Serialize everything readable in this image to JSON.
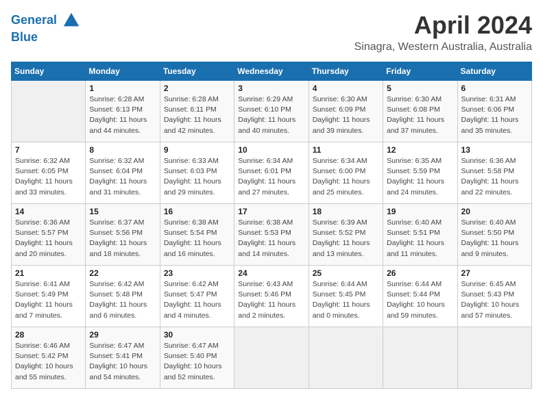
{
  "header": {
    "logo_line1": "General",
    "logo_line2": "Blue",
    "title": "April 2024",
    "subtitle": "Sinagra, Western Australia, Australia"
  },
  "weekdays": [
    "Sunday",
    "Monday",
    "Tuesday",
    "Wednesday",
    "Thursday",
    "Friday",
    "Saturday"
  ],
  "weeks": [
    [
      {
        "day": "",
        "empty": true
      },
      {
        "day": "1",
        "sunrise": "Sunrise: 6:28 AM",
        "sunset": "Sunset: 6:13 PM",
        "daylight": "Daylight: 11 hours and 44 minutes."
      },
      {
        "day": "2",
        "sunrise": "Sunrise: 6:28 AM",
        "sunset": "Sunset: 6:11 PM",
        "daylight": "Daylight: 11 hours and 42 minutes."
      },
      {
        "day": "3",
        "sunrise": "Sunrise: 6:29 AM",
        "sunset": "Sunset: 6:10 PM",
        "daylight": "Daylight: 11 hours and 40 minutes."
      },
      {
        "day": "4",
        "sunrise": "Sunrise: 6:30 AM",
        "sunset": "Sunset: 6:09 PM",
        "daylight": "Daylight: 11 hours and 39 minutes."
      },
      {
        "day": "5",
        "sunrise": "Sunrise: 6:30 AM",
        "sunset": "Sunset: 6:08 PM",
        "daylight": "Daylight: 11 hours and 37 minutes."
      },
      {
        "day": "6",
        "sunrise": "Sunrise: 6:31 AM",
        "sunset": "Sunset: 6:06 PM",
        "daylight": "Daylight: 11 hours and 35 minutes."
      }
    ],
    [
      {
        "day": "7",
        "sunrise": "Sunrise: 6:32 AM",
        "sunset": "Sunset: 6:05 PM",
        "daylight": "Daylight: 11 hours and 33 minutes."
      },
      {
        "day": "8",
        "sunrise": "Sunrise: 6:32 AM",
        "sunset": "Sunset: 6:04 PM",
        "daylight": "Daylight: 11 hours and 31 minutes."
      },
      {
        "day": "9",
        "sunrise": "Sunrise: 6:33 AM",
        "sunset": "Sunset: 6:03 PM",
        "daylight": "Daylight: 11 hours and 29 minutes."
      },
      {
        "day": "10",
        "sunrise": "Sunrise: 6:34 AM",
        "sunset": "Sunset: 6:01 PM",
        "daylight": "Daylight: 11 hours and 27 minutes."
      },
      {
        "day": "11",
        "sunrise": "Sunrise: 6:34 AM",
        "sunset": "Sunset: 6:00 PM",
        "daylight": "Daylight: 11 hours and 25 minutes."
      },
      {
        "day": "12",
        "sunrise": "Sunrise: 6:35 AM",
        "sunset": "Sunset: 5:59 PM",
        "daylight": "Daylight: 11 hours and 24 minutes."
      },
      {
        "day": "13",
        "sunrise": "Sunrise: 6:36 AM",
        "sunset": "Sunset: 5:58 PM",
        "daylight": "Daylight: 11 hours and 22 minutes."
      }
    ],
    [
      {
        "day": "14",
        "sunrise": "Sunrise: 6:36 AM",
        "sunset": "Sunset: 5:57 PM",
        "daylight": "Daylight: 11 hours and 20 minutes."
      },
      {
        "day": "15",
        "sunrise": "Sunrise: 6:37 AM",
        "sunset": "Sunset: 5:56 PM",
        "daylight": "Daylight: 11 hours and 18 minutes."
      },
      {
        "day": "16",
        "sunrise": "Sunrise: 6:38 AM",
        "sunset": "Sunset: 5:54 PM",
        "daylight": "Daylight: 11 hours and 16 minutes."
      },
      {
        "day": "17",
        "sunrise": "Sunrise: 6:38 AM",
        "sunset": "Sunset: 5:53 PM",
        "daylight": "Daylight: 11 hours and 14 minutes."
      },
      {
        "day": "18",
        "sunrise": "Sunrise: 6:39 AM",
        "sunset": "Sunset: 5:52 PM",
        "daylight": "Daylight: 11 hours and 13 minutes."
      },
      {
        "day": "19",
        "sunrise": "Sunrise: 6:40 AM",
        "sunset": "Sunset: 5:51 PM",
        "daylight": "Daylight: 11 hours and 11 minutes."
      },
      {
        "day": "20",
        "sunrise": "Sunrise: 6:40 AM",
        "sunset": "Sunset: 5:50 PM",
        "daylight": "Daylight: 11 hours and 9 minutes."
      }
    ],
    [
      {
        "day": "21",
        "sunrise": "Sunrise: 6:41 AM",
        "sunset": "Sunset: 5:49 PM",
        "daylight": "Daylight: 11 hours and 7 minutes."
      },
      {
        "day": "22",
        "sunrise": "Sunrise: 6:42 AM",
        "sunset": "Sunset: 5:48 PM",
        "daylight": "Daylight: 11 hours and 6 minutes."
      },
      {
        "day": "23",
        "sunrise": "Sunrise: 6:42 AM",
        "sunset": "Sunset: 5:47 PM",
        "daylight": "Daylight: 11 hours and 4 minutes."
      },
      {
        "day": "24",
        "sunrise": "Sunrise: 6:43 AM",
        "sunset": "Sunset: 5:46 PM",
        "daylight": "Daylight: 11 hours and 2 minutes."
      },
      {
        "day": "25",
        "sunrise": "Sunrise: 6:44 AM",
        "sunset": "Sunset: 5:45 PM",
        "daylight": "Daylight: 11 hours and 0 minutes."
      },
      {
        "day": "26",
        "sunrise": "Sunrise: 6:44 AM",
        "sunset": "Sunset: 5:44 PM",
        "daylight": "Daylight: 10 hours and 59 minutes."
      },
      {
        "day": "27",
        "sunrise": "Sunrise: 6:45 AM",
        "sunset": "Sunset: 5:43 PM",
        "daylight": "Daylight: 10 hours and 57 minutes."
      }
    ],
    [
      {
        "day": "28",
        "sunrise": "Sunrise: 6:46 AM",
        "sunset": "Sunset: 5:42 PM",
        "daylight": "Daylight: 10 hours and 55 minutes."
      },
      {
        "day": "29",
        "sunrise": "Sunrise: 6:47 AM",
        "sunset": "Sunset: 5:41 PM",
        "daylight": "Daylight: 10 hours and 54 minutes."
      },
      {
        "day": "30",
        "sunrise": "Sunrise: 6:47 AM",
        "sunset": "Sunset: 5:40 PM",
        "daylight": "Daylight: 10 hours and 52 minutes."
      },
      {
        "day": "",
        "empty": true
      },
      {
        "day": "",
        "empty": true
      },
      {
        "day": "",
        "empty": true
      },
      {
        "day": "",
        "empty": true
      }
    ]
  ]
}
